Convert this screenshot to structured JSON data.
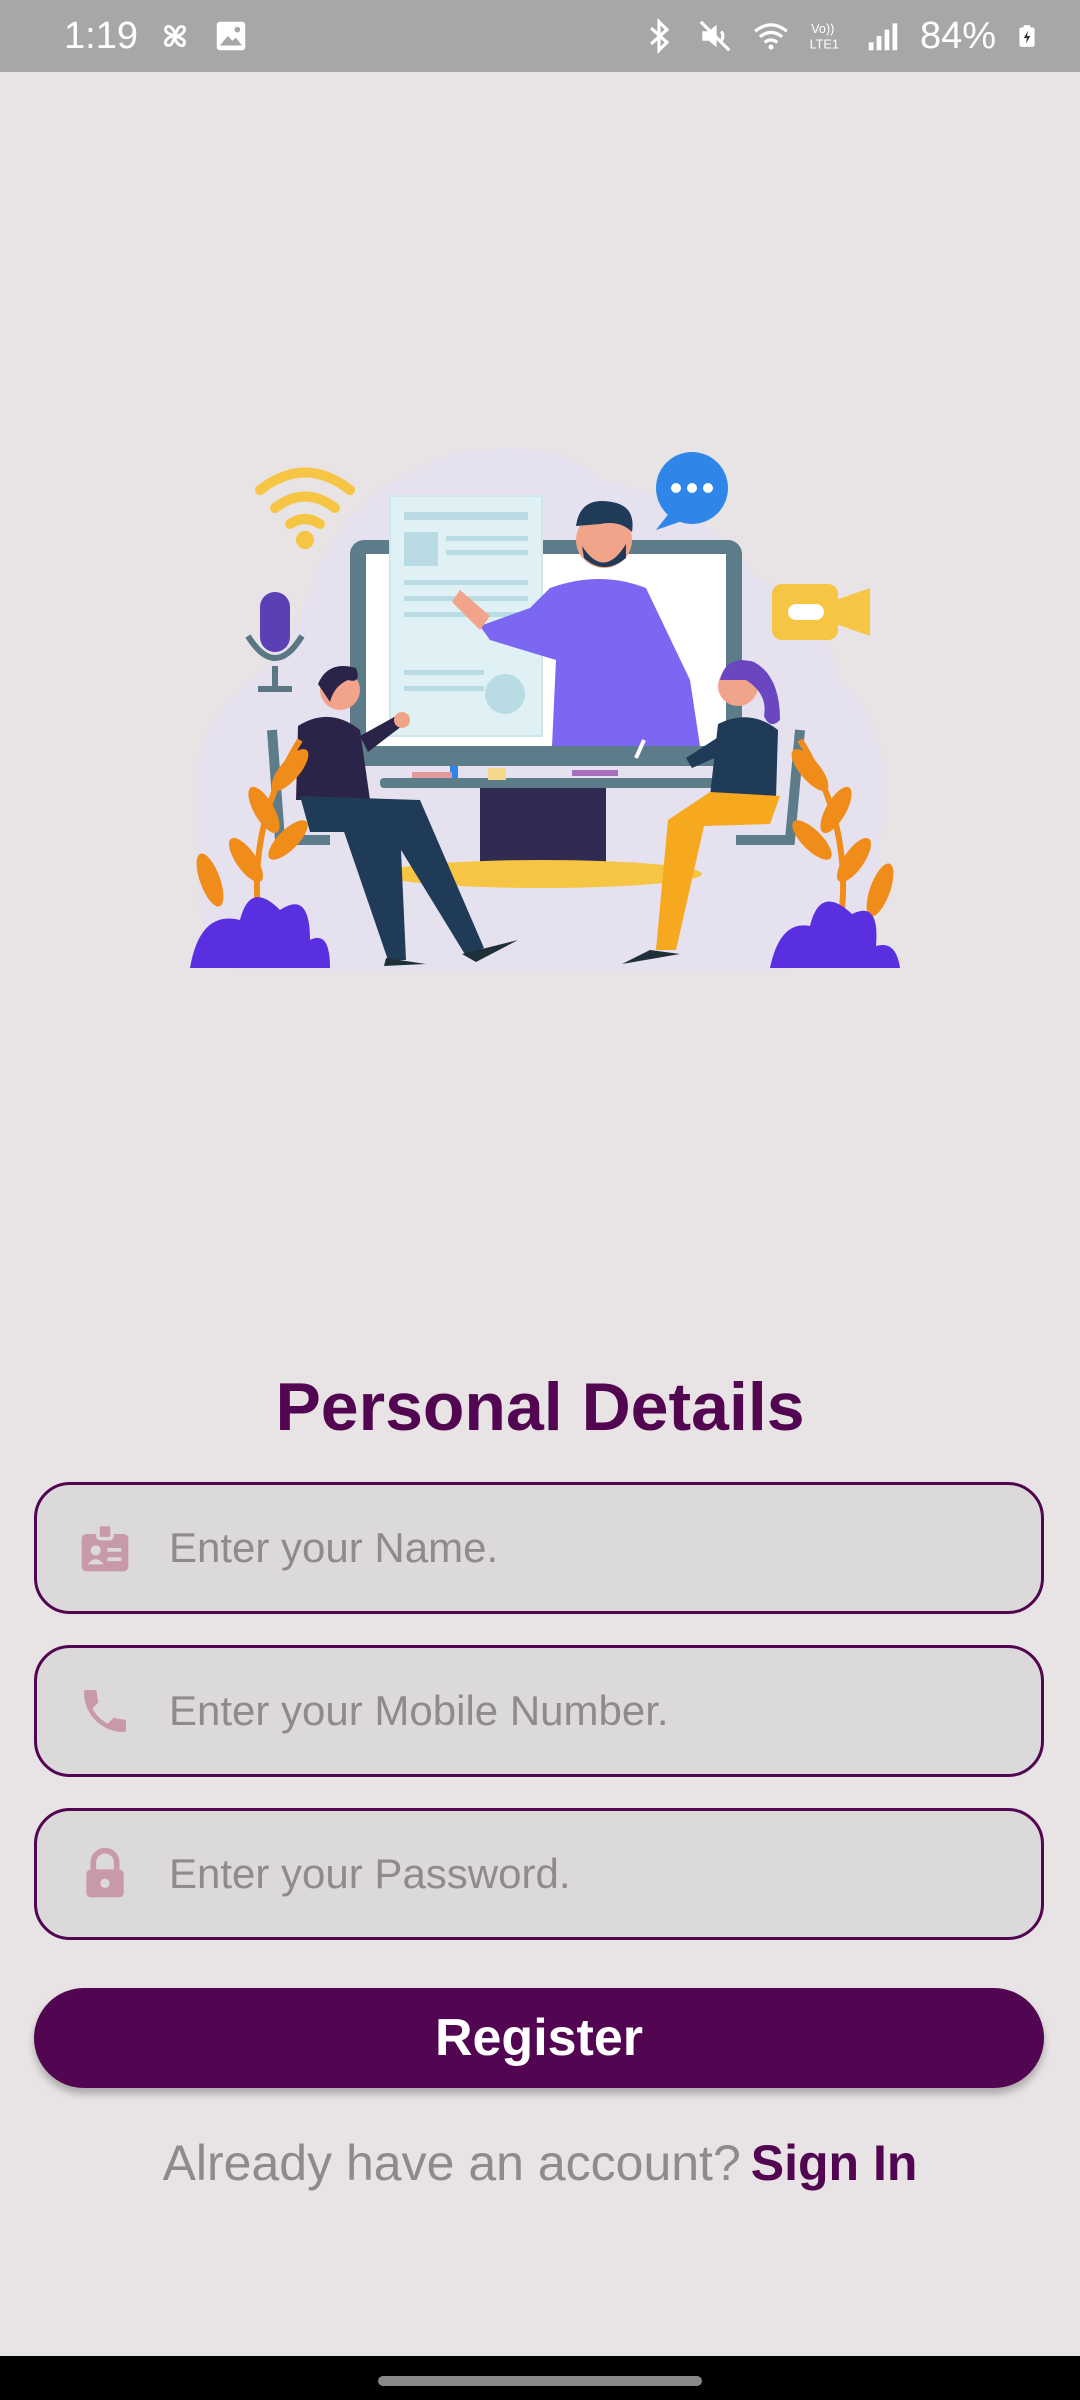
{
  "status_bar": {
    "time": "1:19",
    "battery": "84%",
    "icons": [
      "pinwheel-icon",
      "gallery-icon",
      "bluetooth-icon",
      "mute-icon",
      "wifi-icon",
      "volte-icon",
      "signal-icon",
      "battery-charging-icon"
    ]
  },
  "title": "Personal Details",
  "fields": {
    "name": {
      "placeholder": "Enter your Name.",
      "icon": "id-badge-icon"
    },
    "mobile": {
      "placeholder": "Enter your Mobile Number.",
      "icon": "phone-icon"
    },
    "password": {
      "placeholder": "Enter your Password.",
      "icon": "lock-icon"
    }
  },
  "register_label": "Register",
  "signin": {
    "question": "Already have an account?",
    "link": "Sign In"
  },
  "colors": {
    "primary": "#520550",
    "background": "#e8e3e4",
    "field_bg": "#dcd9db",
    "icon": "#c89aa9",
    "placeholder": "#8f8b8d"
  }
}
